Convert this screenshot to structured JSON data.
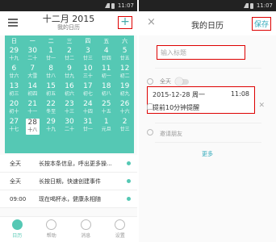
{
  "status": {
    "time": "11:07"
  },
  "left": {
    "month_title": "十二月 2015",
    "month_sub": "我的日历",
    "add_label": "+",
    "weekdays": [
      "日",
      "一",
      "二",
      "三",
      "四",
      "五",
      "六"
    ],
    "days": [
      {
        "n": "29",
        "l": "十九"
      },
      {
        "n": "30",
        "l": "二十"
      },
      {
        "n": "1",
        "l": "廿一"
      },
      {
        "n": "2",
        "l": "廿二"
      },
      {
        "n": "3",
        "l": "廿三"
      },
      {
        "n": "4",
        "l": "廿四"
      },
      {
        "n": "5",
        "l": "廿五"
      },
      {
        "n": "6",
        "l": "廿六"
      },
      {
        "n": "7",
        "l": "大雪"
      },
      {
        "n": "8",
        "l": "廿八"
      },
      {
        "n": "9",
        "l": "廿九"
      },
      {
        "n": "10",
        "l": "三十"
      },
      {
        "n": "11",
        "l": "初一"
      },
      {
        "n": "12",
        "l": "初二"
      },
      {
        "n": "13",
        "l": "初三"
      },
      {
        "n": "14",
        "l": "初四"
      },
      {
        "n": "15",
        "l": "初五"
      },
      {
        "n": "16",
        "l": "初六"
      },
      {
        "n": "17",
        "l": "初七"
      },
      {
        "n": "18",
        "l": "初八"
      },
      {
        "n": "19",
        "l": "初九"
      },
      {
        "n": "20",
        "l": "初十"
      },
      {
        "n": "21",
        "l": "十一"
      },
      {
        "n": "22",
        "l": "冬至"
      },
      {
        "n": "23",
        "l": "十三"
      },
      {
        "n": "24",
        "l": "十四"
      },
      {
        "n": "25",
        "l": "十五"
      },
      {
        "n": "26",
        "l": "十六"
      },
      {
        "n": "27",
        "l": "十七"
      },
      {
        "n": "28",
        "l": "十八"
      },
      {
        "n": "29",
        "l": "十九"
      },
      {
        "n": "30",
        "l": "二十"
      },
      {
        "n": "31",
        "l": "廿一"
      },
      {
        "n": "1",
        "l": "元旦"
      },
      {
        "n": "2",
        "l": "廿三"
      }
    ],
    "today_index": 29,
    "events": [
      {
        "time": "全天",
        "text": "长按本条信息，呼出更多操..."
      },
      {
        "time": "全天",
        "text": "长按日期，快速创建事件"
      },
      {
        "time": "09:00",
        "text": "现在喝杯水，健康永相随"
      }
    ],
    "tabs": [
      "日历",
      "帮助",
      "消息",
      "设置"
    ]
  },
  "right": {
    "close_label": "×",
    "title": "我的日历",
    "save_label": "保存",
    "title_placeholder": "输入标题",
    "allday_label": "全天",
    "date": "2015-12-28 周一",
    "time": "11:08",
    "reminder": "提前10分钟提醒",
    "invite_label": "邀请朋友",
    "more_label": "更多"
  },
  "colors": {
    "accent": "#55c8b4",
    "highlight": "#dd0000"
  }
}
